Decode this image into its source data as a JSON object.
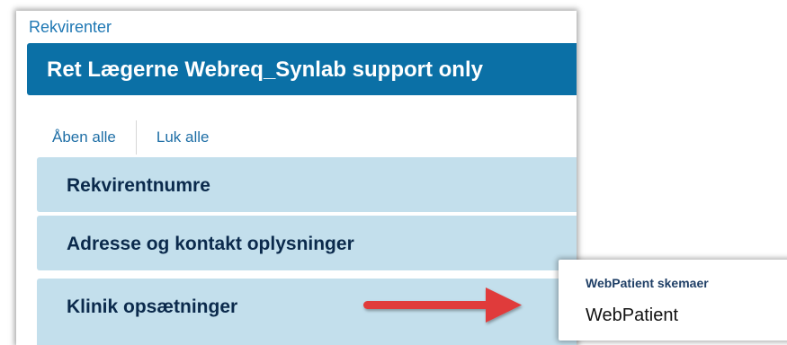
{
  "breadcrumb": "Rekvirenter",
  "header": {
    "title": "Ret Lægerne Webreq_Synlab support only"
  },
  "actions": {
    "open_all": "Åben alle",
    "close_all": "Luk alle"
  },
  "accordion": {
    "items": [
      {
        "label": "Rekvirentnumre"
      },
      {
        "label": "Adresse og kontakt oplysninger"
      },
      {
        "label": "Klinik opsætninger"
      }
    ]
  },
  "popup": {
    "heading": "WebPatient skemaer",
    "value": "WebPatient"
  },
  "colors": {
    "header_bg": "#0b70a6",
    "accordion_bg": "#c3dfec",
    "link": "#1f6fa6",
    "arrow": "#e03a3a"
  }
}
